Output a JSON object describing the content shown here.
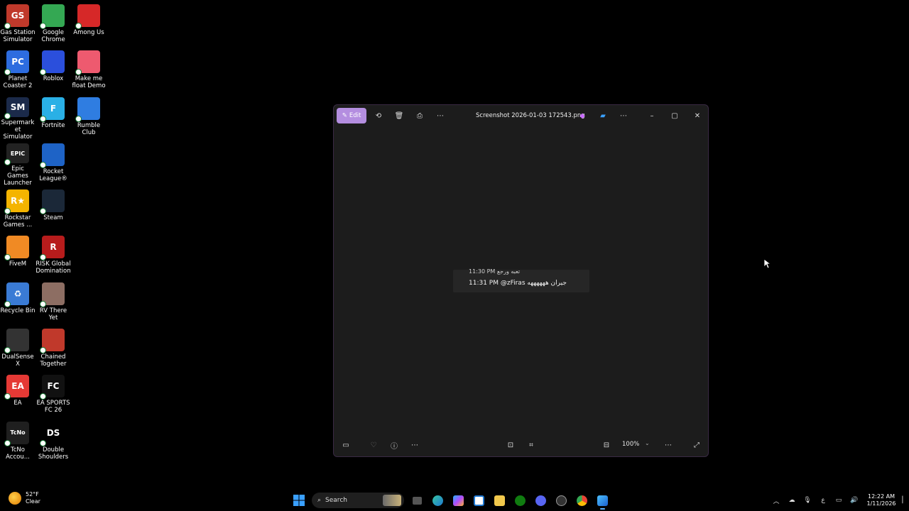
{
  "desktop": {
    "icons": [
      {
        "label": "Gas Station Simulator",
        "icon": "gas-station-sim-icon",
        "color": "#c0392b"
      },
      {
        "label": "Google Chrome",
        "icon": "chrome-icon",
        "color": "#34a853"
      },
      {
        "label": "Among Us",
        "icon": "among-us-icon",
        "color": "#d62828"
      },
      {
        "label": "Planet Coaster 2",
        "icon": "planet-coaster-icon",
        "color": "#2d6cdf"
      },
      {
        "label": "Roblox",
        "icon": "roblox-icon",
        "color": "#2b4fdc"
      },
      {
        "label": "Make me float Demo",
        "icon": "balloon-icon",
        "color": "#ee5a6f"
      },
      {
        "label": "Supermarket Simulator",
        "icon": "supermarket-icon",
        "color": "#1b2a4a"
      },
      {
        "label": "Fortnite",
        "icon": "fortnite-icon",
        "color": "#2ab0e6"
      },
      {
        "label": "Rumble Club",
        "icon": "rumble-club-icon",
        "color": "#2f7de1"
      },
      {
        "label": "Epic Games Launcher",
        "icon": "epic-games-icon",
        "color": "#222222"
      },
      {
        "label": "Rocket League®",
        "icon": "rocket-league-icon",
        "color": "#1e63c6"
      },
      {
        "label": "",
        "icon": "empty",
        "color": ""
      },
      {
        "label": "Rockstar Games ...",
        "icon": "rockstar-icon",
        "color": "#f4b400"
      },
      {
        "label": "Steam",
        "icon": "steam-icon",
        "color": "#1b2838"
      },
      {
        "label": "",
        "icon": "empty",
        "color": ""
      },
      {
        "label": "FiveM",
        "icon": "fivem-icon",
        "color": "#f08a24"
      },
      {
        "label": "RISK Global Domination",
        "icon": "risk-icon",
        "color": "#b71c1c"
      },
      {
        "label": "",
        "icon": "empty",
        "color": ""
      },
      {
        "label": "Recycle Bin",
        "icon": "recycle-bin-icon",
        "color": "#3a7bd5"
      },
      {
        "label": "RV There Yet",
        "icon": "rv-there-yet-icon",
        "color": "#8d6e63"
      },
      {
        "label": "",
        "icon": "empty",
        "color": ""
      },
      {
        "label": "DualSenseX",
        "icon": "dualsensex-icon",
        "color": "#333333"
      },
      {
        "label": "Chained Together",
        "icon": "chained-together-icon",
        "color": "#c0392b"
      },
      {
        "label": "",
        "icon": "empty",
        "color": ""
      },
      {
        "label": "EA",
        "icon": "ea-icon",
        "color": "#e53935"
      },
      {
        "label": "EA SPORTS FC 26",
        "icon": "ea-fc-icon",
        "color": "#111111"
      },
      {
        "label": "",
        "icon": "empty",
        "color": ""
      },
      {
        "label": "TcNo Accou...",
        "icon": "tcno-icon",
        "color": "#1f1f1f"
      },
      {
        "label": "Double Shoulders",
        "icon": "double-shoulders-icon",
        "color": "#000000"
      }
    ],
    "icon_letters": {
      "Gas Station Simulator": "GS",
      "Google Chrome": "",
      "Among Us": "",
      "Planet Coaster 2": "PC",
      "Roblox": "",
      "Make me float Demo": "",
      "Supermarket Simulator": "SM",
      "Fortnite": "F",
      "Rumble Club": "",
      "Epic Games Launcher": "EPIC",
      "Rocket League®": "",
      "Rockstar Games ...": "R★",
      "Steam": "",
      "FiveM": "",
      "RISK Global Domination": "R",
      "Recycle Bin": "♻",
      "RV There Yet": "",
      "DualSenseX": "",
      "Chained Together": "",
      "EA": "EA",
      "EA SPORTS FC 26": "FC",
      "TcNo Accou...": "TcNo",
      "Double Shoulders": "DS"
    }
  },
  "photos": {
    "edit_label": "Edit",
    "title": "Screenshot 2026-01-03 172543.png",
    "zoom": "100%",
    "image_lines": {
      "line1": "11:30 PM تعبه ورجع",
      "line2": "11:31 PM @zFiras جيران ههههههه"
    }
  },
  "taskbar": {
    "weather_temp": "52°F",
    "weather_desc": "Clear",
    "search_label": "Search",
    "time": "12:22 AM",
    "date": "1/11/2026",
    "tray_lang": "ع"
  }
}
